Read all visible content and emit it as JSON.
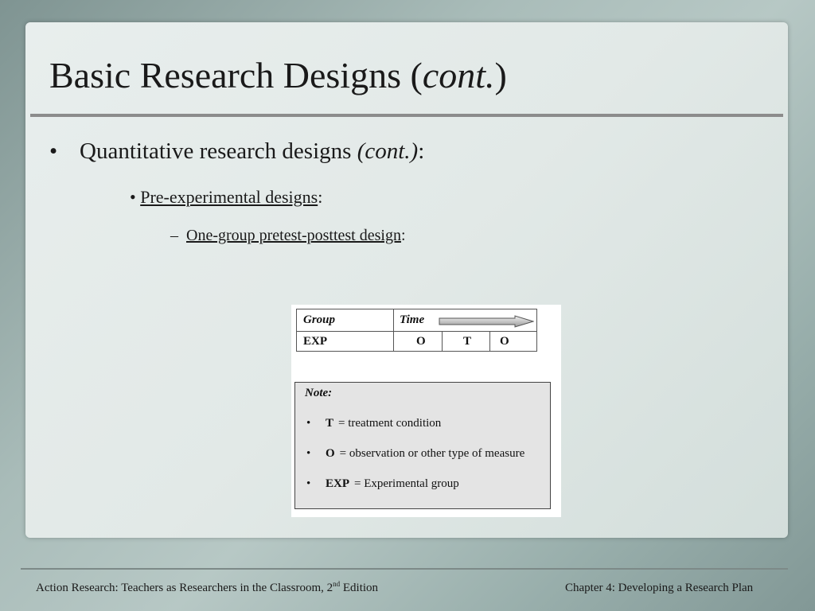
{
  "slide": {
    "title_main": "Basic Research Designs (",
    "title_italic": "cont.",
    "title_end": ")"
  },
  "bullets": {
    "level1_bullet": "•",
    "level1_text": "Quantitative research designs ",
    "level1_italic": "(cont.)",
    "level1_colon": ":",
    "level2_bullet": "•",
    "level2_link": "Pre-experimental designs",
    "level2_colon": ":",
    "level3_dash": "–",
    "level3_link": "One-group pretest-posttest design",
    "level3_colon": ":"
  },
  "figure": {
    "header_group": "Group",
    "header_time": "Time",
    "row_group": "EXP",
    "row_cells": [
      "O",
      "T",
      "O"
    ],
    "arrow_icon": "right-arrow-icon",
    "note_title": "Note:",
    "note_items": [
      {
        "bullet": "•",
        "term": "T",
        "desc": "= treatment condition"
      },
      {
        "bullet": "•",
        "term": "O",
        "desc": "= observation or other type of measure"
      },
      {
        "bullet": "•",
        "term": "EXP",
        "desc": "= Experimental group"
      }
    ]
  },
  "footer": {
    "left_text": "Action Research: Teachers as Researchers in the Classroom, 2",
    "left_sup": "nd",
    "left_end": " Edition",
    "right_text": "Chapter 4:  Developing a Research Plan"
  }
}
